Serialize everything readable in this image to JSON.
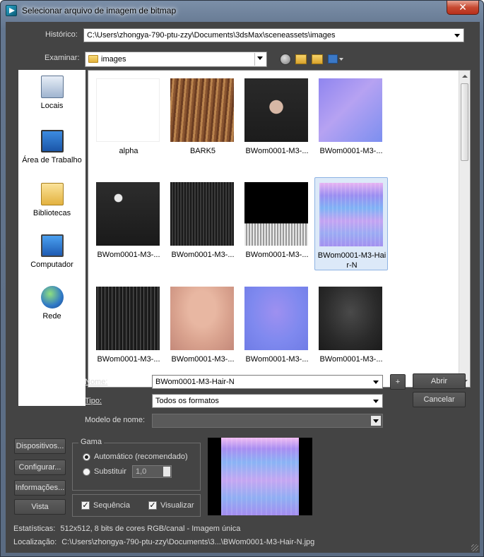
{
  "window": {
    "title": "Selecionar arquivo de imagem de bitmap",
    "close_glyph": "✕"
  },
  "history": {
    "label": "Histórico:",
    "value": "C:\\Users\\zhongya-790-ptu-zzy\\Documents\\3dsMax\\sceneassets\\images"
  },
  "lookin": {
    "label": "Examinar:",
    "value": "images",
    "folder_icon": "folder-icon"
  },
  "toolbar": {
    "back_icon": "back-icon",
    "up_icon": "up-folder-icon",
    "new_folder_icon": "new-folder-icon",
    "views_icon": "view-menu-icon"
  },
  "places": [
    {
      "label": "Locais",
      "icon": "recent-places-icon"
    },
    {
      "label": "Área de Trabalho",
      "icon": "desktop-icon"
    },
    {
      "label": "Bibliotecas",
      "icon": "libraries-icon"
    },
    {
      "label": "Computador",
      "icon": "computer-icon"
    },
    {
      "label": "Rede",
      "icon": "network-icon"
    }
  ],
  "files": [
    {
      "name": "alpha",
      "thumb": "alpha"
    },
    {
      "name": "BARK5",
      "thumb": "bark"
    },
    {
      "name": "BWom0001-M3-...",
      "thumb": "diffuse-cloth"
    },
    {
      "name": "BWom0001-M3-...",
      "thumb": "normal-body"
    },
    {
      "name": "BWom0001-M3-...",
      "thumb": "dark-alpha"
    },
    {
      "name": "BWom0001-M3-...",
      "thumb": "dark-hair"
    },
    {
      "name": "BWom0001-M3-...",
      "thumb": "hair-alpha"
    },
    {
      "name": "BWom0001-M3-Hair-N",
      "thumb": "hair-normal",
      "selected": true
    },
    {
      "name": "BWom0001-M3-...",
      "thumb": "hair-spec"
    },
    {
      "name": "BWom0001-M3-...",
      "thumb": "skin"
    },
    {
      "name": "BWom0001-M3-...",
      "thumb": "face-normal"
    },
    {
      "name": "BWom0001-M3-...",
      "thumb": "face-spec"
    }
  ],
  "form": {
    "name_label": "Nome:",
    "name_value": "BWom0001-M3-Hair-N",
    "type_label": "Tipo:",
    "type_value": "Todos os formatos",
    "pattern_label": "Modelo de nome:",
    "pattern_value": "",
    "plus_label": "+",
    "open_label": "Abrir",
    "cancel_label": "Cancelar"
  },
  "side_buttons": {
    "devices": "Dispositivos...",
    "setup": "Configurar...",
    "info": "Informações...",
    "view": "Vista"
  },
  "gamma": {
    "title": "Gama",
    "auto_label": "Automático (recomendado)",
    "override_label": "Substituir",
    "override_value": "1,0",
    "auto_selected": true
  },
  "options": {
    "sequence_label": "Sequência",
    "sequence_checked": true,
    "preview_label": "Visualizar",
    "preview_checked": true
  },
  "status": {
    "stats_label": "Estatísticas:",
    "stats_value": "512x512, 8 bits de cores RGB/canal - Imagem única",
    "location_label": "Localização:",
    "location_value": "C:\\Users\\zhongya-790-ptu-zzy\\Documents\\3...\\BWom0001-M3-Hair-N.jpg"
  }
}
